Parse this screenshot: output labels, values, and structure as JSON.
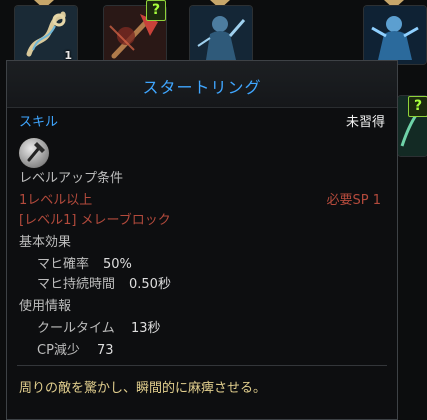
{
  "background_slots": [
    {
      "icon": "chain-rope-icon",
      "count": "1",
      "has_arrow": true,
      "has_quest": false
    },
    {
      "icon": "axe-strike-icon",
      "count": "",
      "has_arrow": false,
      "has_quest": true,
      "quest_label": "?"
    },
    {
      "icon": "armored-warrior-icon",
      "count": "",
      "has_arrow": true,
      "has_quest": false
    },
    {
      "icon": "blue-warrior-icon",
      "count": "",
      "has_arrow": true,
      "has_quest": false
    }
  ],
  "tooltip": {
    "title": "スタートリング",
    "category_label": "スキル",
    "learn_status": "未習得",
    "skill_icon": "hammer-icon",
    "level_up_header": "レベルアップ条件",
    "level_requirement": "1レベル以上",
    "required_sp": "必要SP 1",
    "prerequisite_skill": "[レベル1] メレーブロック",
    "basic_effect_header": "基本効果",
    "effects": [
      {
        "label": "マヒ確率",
        "value": "50%"
      },
      {
        "label": "マヒ持続時間",
        "value": "0.50秒"
      }
    ],
    "usage_header": "使用情報",
    "usage": [
      {
        "label": "クールタイム",
        "value": "13秒"
      },
      {
        "label": "CP減少",
        "value": "73"
      }
    ],
    "description": "周りの敵を驚かし、瞬間的に麻痺させる。"
  },
  "colors": {
    "title_blue": "#3fa6ff",
    "requirement_red": "#b34a3c",
    "description_gold": "#e2cf8e",
    "quest_green": "#a8ff3c"
  }
}
